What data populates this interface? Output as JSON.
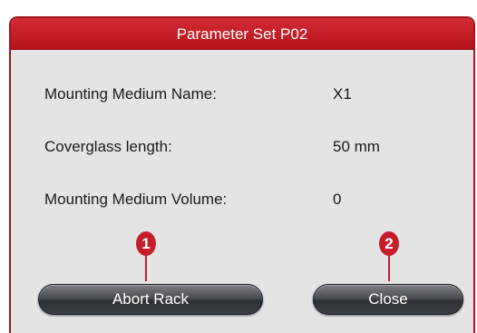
{
  "dialog": {
    "title": "Parameter Set P02",
    "parameters": [
      {
        "label": "Mounting Medium Name:",
        "value": "X1"
      },
      {
        "label": "Coverglass length:",
        "value": "50 mm"
      },
      {
        "label": "Mounting Medium Volume:",
        "value": "0"
      }
    ],
    "buttons": {
      "abort_label": "Abort Rack",
      "close_label": "Close"
    }
  },
  "callouts": [
    {
      "number": "1"
    },
    {
      "number": "2"
    }
  ],
  "colors": {
    "accent_red": "#c41e2a",
    "title_bar_red": "#d12a32",
    "dialog_background": "#e4e4e4",
    "button_dark": "#3a3d41"
  }
}
